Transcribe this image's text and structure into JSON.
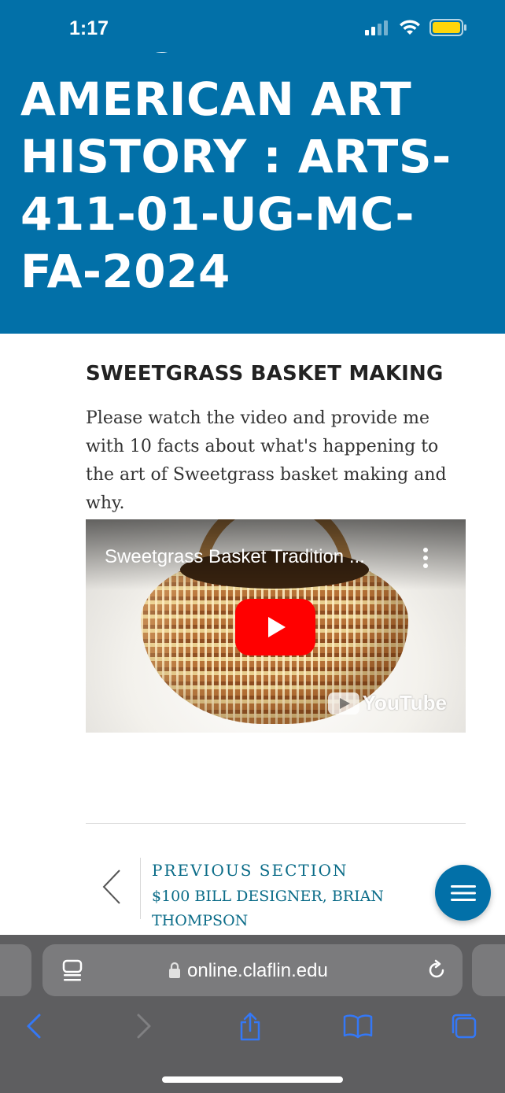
{
  "status_bar": {
    "time": "1:17"
  },
  "header": {
    "clipped_text": "AFRICAN",
    "course_title": "AMERICAN ART HISTORY : ARTS-411-01-UG-MC-FA-2024"
  },
  "content": {
    "section_heading": "SWEETGRASS BASKET MAKING",
    "instructions": "Please watch the video and provide me with 10 facts about what's happening to the art of Sweetgrass basket making and why.",
    "video": {
      "title": "Sweetgrass Basket Tradition ...",
      "brand": "YouTube"
    }
  },
  "navigation": {
    "previous_label": "PREVIOUS SECTION",
    "previous_title": "$100 BILL DESIGNER, BRIAN THOMPSON"
  },
  "browser": {
    "url": "online.claflin.edu"
  },
  "colors": {
    "brand_blue": "#0270a8",
    "link_teal": "#0b6c88",
    "youtube_red": "#ff0000",
    "toolbar_gray": "#5e5e60",
    "safari_blue": "#3478f6"
  }
}
